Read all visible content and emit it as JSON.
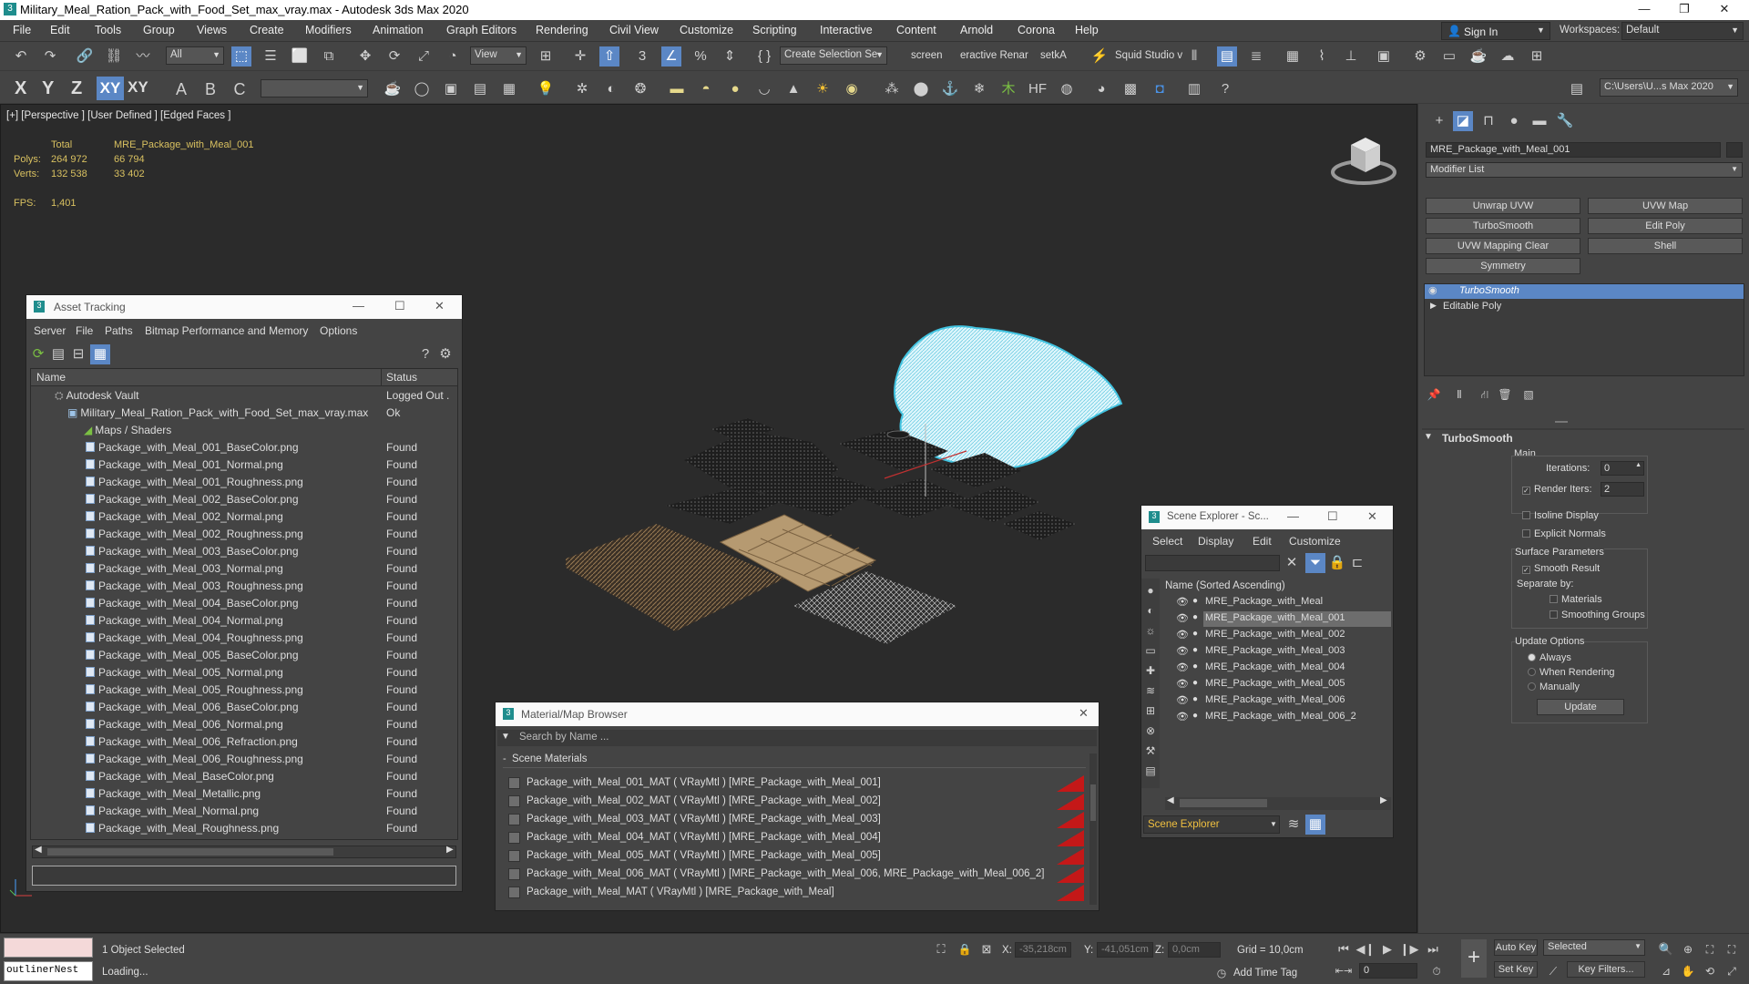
{
  "window": {
    "title": "Military_Meal_Ration_Pack_with_Food_Set_max_vray.max - Autodesk 3ds Max 2020"
  },
  "menu": [
    "File",
    "Edit",
    "Tools",
    "Group",
    "Views",
    "Create",
    "Modifiers",
    "Animation",
    "Graph Editors",
    "Rendering",
    "Civil View",
    "Customize",
    "Scripting",
    "Interactive",
    "Content",
    "Arnold",
    "Corona",
    "Help"
  ],
  "signin": {
    "label": "Sign In",
    "workspaces_label": "Workspaces:",
    "workspace": "Default"
  },
  "toolbar": {
    "selection_filter": "All",
    "ref_coord": "View",
    "named_selection": "Create Selection Se",
    "tabs": [
      "screen",
      "eractive Renar",
      "setkA"
    ],
    "squid": "Squid Studio v",
    "axis_labels": [
      "X",
      "Y",
      "Z",
      "XY",
      "XY"
    ],
    "path": "C:\\Users\\U...s Max 2020"
  },
  "viewport": {
    "label": "[+] [Perspective ] [User Defined ] [Edged Faces ]",
    "stats": {
      "total_label": "Total",
      "object_name": "MRE_Package_with_Meal_001",
      "polys_label": "Polys:",
      "polys_total": "264 972",
      "polys_sel": "66 794",
      "verts_label": "Verts:",
      "verts_total": "132 538",
      "verts_sel": "33 402",
      "fps_label": "FPS:",
      "fps": "1,401"
    }
  },
  "asset_tracking": {
    "title": "Asset Tracking",
    "menu": [
      "Server",
      "File",
      "Paths",
      "Bitmap Performance and Memory",
      "Options"
    ],
    "columns": [
      "Name",
      "Status"
    ],
    "vault": {
      "name": "Autodesk Vault",
      "status": "Logged Out ."
    },
    "file": {
      "name": "Military_Meal_Ration_Pack_with_Food_Set_max_vray.max",
      "status": "Ok"
    },
    "group": "Maps / Shaders",
    "maps": [
      {
        "name": "Package_with_Meal_001_BaseColor.png",
        "status": "Found"
      },
      {
        "name": "Package_with_Meal_001_Normal.png",
        "status": "Found"
      },
      {
        "name": "Package_with_Meal_001_Roughness.png",
        "status": "Found"
      },
      {
        "name": "Package_with_Meal_002_BaseColor.png",
        "status": "Found"
      },
      {
        "name": "Package_with_Meal_002_Normal.png",
        "status": "Found"
      },
      {
        "name": "Package_with_Meal_002_Roughness.png",
        "status": "Found"
      },
      {
        "name": "Package_with_Meal_003_BaseColor.png",
        "status": "Found"
      },
      {
        "name": "Package_with_Meal_003_Normal.png",
        "status": "Found"
      },
      {
        "name": "Package_with_Meal_003_Roughness.png",
        "status": "Found"
      },
      {
        "name": "Package_with_Meal_004_BaseColor.png",
        "status": "Found"
      },
      {
        "name": "Package_with_Meal_004_Normal.png",
        "status": "Found"
      },
      {
        "name": "Package_with_Meal_004_Roughness.png",
        "status": "Found"
      },
      {
        "name": "Package_with_Meal_005_BaseColor.png",
        "status": "Found"
      },
      {
        "name": "Package_with_Meal_005_Normal.png",
        "status": "Found"
      },
      {
        "name": "Package_with_Meal_005_Roughness.png",
        "status": "Found"
      },
      {
        "name": "Package_with_Meal_006_BaseColor.png",
        "status": "Found"
      },
      {
        "name": "Package_with_Meal_006_Normal.png",
        "status": "Found"
      },
      {
        "name": "Package_with_Meal_006_Refraction.png",
        "status": "Found"
      },
      {
        "name": "Package_with_Meal_006_Roughness.png",
        "status": "Found"
      },
      {
        "name": "Package_with_Meal_BaseColor.png",
        "status": "Found"
      },
      {
        "name": "Package_with_Meal_Metallic.png",
        "status": "Found"
      },
      {
        "name": "Package_with_Meal_Normal.png",
        "status": "Found"
      },
      {
        "name": "Package_with_Meal_Roughness.png",
        "status": "Found"
      }
    ]
  },
  "material_browser": {
    "title": "Material/Map Browser",
    "search_placeholder": "Search by Name ...",
    "section": "Scene Materials",
    "materials": [
      "Package_with_Meal_001_MAT  ( VRayMtl )  [MRE_Package_with_Meal_001]",
      "Package_with_Meal_002_MAT  ( VRayMtl )  [MRE_Package_with_Meal_002]",
      "Package_with_Meal_003_MAT  ( VRayMtl )  [MRE_Package_with_Meal_003]",
      "Package_with_Meal_004_MAT  ( VRayMtl )  [MRE_Package_with_Meal_004]",
      "Package_with_Meal_005_MAT  ( VRayMtl )  [MRE_Package_with_Meal_005]",
      "Package_with_Meal_006_MAT  ( VRayMtl )  [MRE_Package_with_Meal_006, MRE_Package_with_Meal_006_2]",
      "Package_with_Meal_MAT  ( VRayMtl )  [MRE_Package_with_Meal]"
    ]
  },
  "scene_explorer": {
    "title": "Scene Explorer - Sc...",
    "menu": [
      "Select",
      "Display",
      "Edit",
      "Customize"
    ],
    "column": "Name (Sorted Ascending)",
    "items": [
      "MRE_Package_with_Meal",
      "MRE_Package_with_Meal_001",
      "MRE_Package_with_Meal_002",
      "MRE_Package_with_Meal_003",
      "MRE_Package_with_Meal_004",
      "MRE_Package_with_Meal_005",
      "MRE_Package_with_Meal_006",
      "MRE_Package_with_Meal_006_2"
    ],
    "selected_index": 1,
    "footer": "Scene Explorer"
  },
  "command_panel": {
    "object_name": "MRE_Package_with_Meal_001",
    "modifier_list": "Modifier List",
    "buttons": [
      "Unwrap UVW",
      "UVW Map",
      "TurboSmooth",
      "Edit Poly",
      "UVW Mapping Clear",
      "Shell",
      "Symmetry"
    ],
    "stack": [
      "TurboSmooth",
      "Editable Poly"
    ],
    "rollout": {
      "title": "TurboSmooth",
      "main": "Main",
      "iterations_label": "Iterations:",
      "iterations": "0",
      "render_iters_label": "Render Iters:",
      "render_iters": "2",
      "isoline": "Isoline Display",
      "explicit": "Explicit Normals",
      "surface": "Surface Parameters",
      "smooth_result": "Smooth Result",
      "separate_by": "Separate by:",
      "materials": "Materials",
      "smoothing_groups": "Smoothing Groups",
      "update_options": "Update Options",
      "always": "Always",
      "when_rendering": "When Rendering",
      "manually": "Manually",
      "update_btn": "Update"
    }
  },
  "status": {
    "maxscript": "outlinerNest",
    "selected": "1 Object Selected",
    "loading": "Loading...",
    "x_label": "X:",
    "x": "-35,218cm",
    "y_label": "Y:",
    "y": "-41,051cm",
    "z_label": "Z:",
    "z": "0,0cm",
    "grid": "Grid = 10,0cm",
    "add_time_tag": "Add Time Tag",
    "auto_key": "Auto Key",
    "set_key": "Set Key",
    "selected_combo": "Selected",
    "key_filters": "Key Filters...",
    "frame": "0"
  }
}
